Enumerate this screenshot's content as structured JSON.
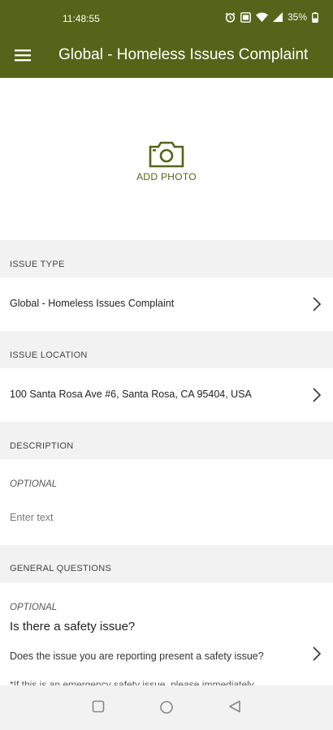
{
  "status_bar": {
    "time": "11:48:55",
    "battery": "35%"
  },
  "app_bar": {
    "title": "Global - Homeless Issues Complaint",
    "menu_icon": "hamburger-menu-icon"
  },
  "photo": {
    "label": "ADD PHOTO",
    "icon": "camera-icon",
    "accent": "#546418"
  },
  "issue_type": {
    "header": "ISSUE TYPE",
    "value": "Global - Homeless Issues Complaint"
  },
  "issue_location": {
    "header": "ISSUE LOCATION",
    "value": "100 Santa Rosa Ave #6, Santa Rosa, CA 95404, USA"
  },
  "description": {
    "header": "DESCRIPTION",
    "optional": "OPTIONAL",
    "placeholder": "Enter text"
  },
  "general_questions": {
    "header": "GENERAL QUESTIONS",
    "optional": "OPTIONAL",
    "question": "Is there a safety issue?",
    "prompt": "Does the issue you are reporting present a safety issue?",
    "note": "*If this is an emergency safety issue, please immediately"
  }
}
